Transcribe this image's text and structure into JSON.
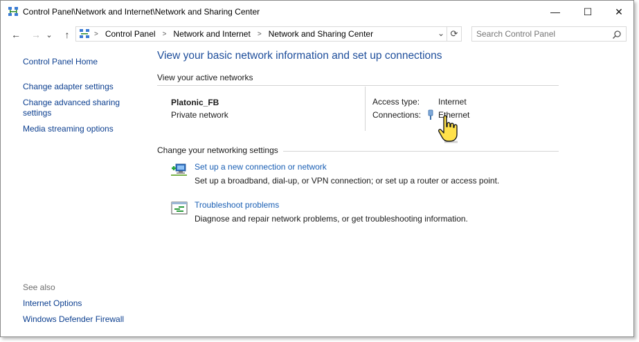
{
  "window": {
    "title": "Control Panel\\Network and Internet\\Network and Sharing Center",
    "minimize": "—",
    "maximize": "☐",
    "close": "✕"
  },
  "nav": {
    "back": "←",
    "forward": "→",
    "recent": "⌄",
    "up": "↑",
    "breadcrumb": [
      "Control Panel",
      "Network and Internet",
      "Network and Sharing Center"
    ],
    "dropdown": "⌄",
    "refresh": "⟳"
  },
  "search": {
    "placeholder": "Search Control Panel"
  },
  "sidebar": {
    "home": "Control Panel Home",
    "items": [
      "Change adapter settings",
      "Change advanced sharing settings",
      "Media streaming options"
    ],
    "see_also_label": "See also",
    "see_also": [
      "Internet Options",
      "Windows Defender Firewall"
    ]
  },
  "main": {
    "title": "View your basic network information and set up connections",
    "active_networks_label": "View your active networks",
    "network": {
      "name": "Platonic_FB",
      "type": "Private network",
      "access_type_label": "Access type:",
      "access_type_value": "Internet",
      "connections_label": "Connections:",
      "connection_link": "Ethernet"
    },
    "settings_label": "Change your networking settings",
    "tasks": [
      {
        "title": "Set up a new connection or network",
        "desc": "Set up a broadband, dial-up, or VPN connection; or set up a router or access point."
      },
      {
        "title": "Troubleshoot problems",
        "desc": "Diagnose and repair network problems, or get troubleshooting information."
      }
    ]
  },
  "colors": {
    "link": "#0b3e8f",
    "heading": "#1e4e9b",
    "accent": "#1a5fb4"
  },
  "icons": [
    "control-panel-icon",
    "search-icon",
    "ethernet-icon",
    "new-connection-icon",
    "troubleshoot-icon",
    "hand-cursor-icon"
  ]
}
